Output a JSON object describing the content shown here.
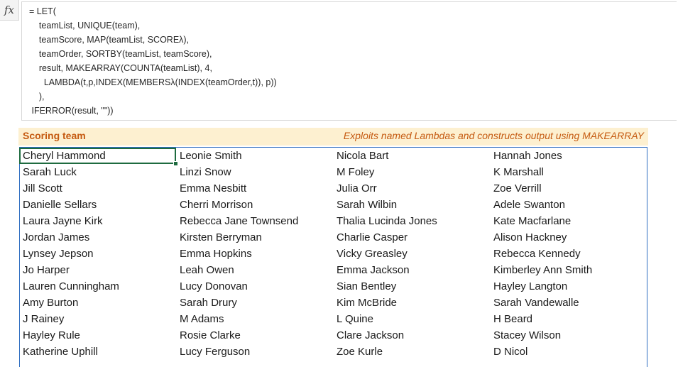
{
  "formula_bar": {
    "fx_label": "fx",
    "lines": [
      "= LET(",
      "    teamList, UNIQUE(team),",
      "    teamScore, MAP(teamList, SCOREλ),",
      "    teamOrder, SORTBY(teamList, teamScore),",
      "    result, MAKEARRAY(COUNTA(teamList), 4,",
      "      LAMBDA(t,p,INDEX(MEMBERSλ(INDEX(teamOrder,t)), p))",
      "    ),",
      " IFERROR(result, \"\"))"
    ]
  },
  "header": {
    "title": "Scoring team",
    "note": "Exploits named Lambdas and constructs output using MAKEARRAY"
  },
  "grid": {
    "rows": [
      [
        "Cheryl Hammond",
        "Leonie Smith",
        "Nicola Bart",
        "Hannah Jones"
      ],
      [
        "Sarah Luck",
        "Linzi Snow",
        "M Foley",
        "K Marshall"
      ],
      [
        "Jill Scott",
        "Emma Nesbitt",
        "Julia Orr",
        "Zoe Verrill"
      ],
      [
        "Danielle Sellars",
        "Cherri Morrison",
        "Sarah Wilbin",
        "Adele Swanton"
      ],
      [
        "Laura Jayne Kirk",
        "Rebecca Jane Townsend",
        "Thalia Lucinda Jones",
        "Kate Macfarlane"
      ],
      [
        "Jordan James",
        "Kirsten Berryman",
        "Charlie Casper",
        "Alison Hackney"
      ],
      [
        "Lynsey Jepson",
        "Emma Hopkins",
        "Vicky Greasley",
        "Rebecca Kennedy"
      ],
      [
        "Jo Harper",
        "Leah Owen",
        "Emma Jackson",
        "Kimberley Ann Smith"
      ],
      [
        "Lauren Cunningham",
        "Lucy Donovan",
        "Sian Bentley",
        "Hayley Langton"
      ],
      [
        "Amy Burton",
        "Sarah Drury",
        "Kim McBride",
        "Sarah Vandewalle"
      ],
      [
        "J Rainey",
        "M Adams",
        "L Quine",
        "H Beard"
      ],
      [
        "Hayley Rule",
        "Rosie Clarke",
        "Clare Jackson",
        "Stacey Wilson"
      ],
      [
        "Katherine Uphill",
        "Lucy Ferguson",
        "Zoe Kurle",
        "D Nicol"
      ]
    ]
  }
}
